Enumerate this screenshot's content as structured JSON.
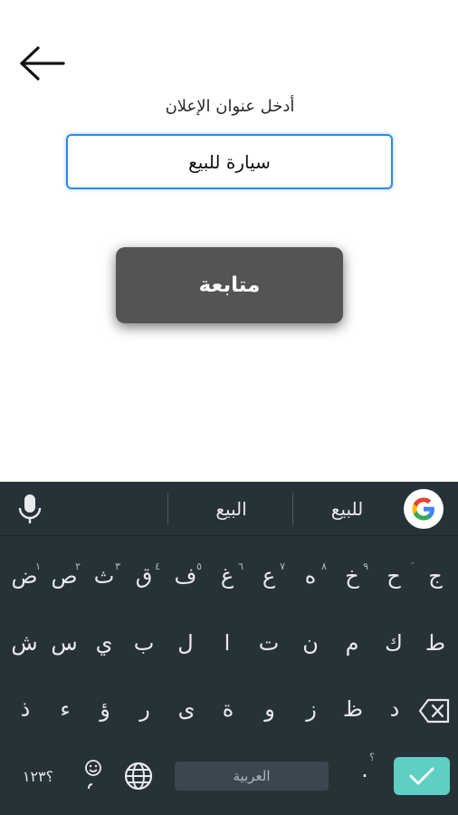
{
  "screen": {
    "title_label": "أدخل  عنوان الإعلان",
    "input_value": "سيارة للبيع",
    "continue_label": "متابعة"
  },
  "keyboard": {
    "suggestions": [
      "للبيع",
      "البيع"
    ],
    "row1": [
      {
        "key": "ج",
        "hint": ""
      },
      {
        "key": "ح",
        "hint": "َ"
      },
      {
        "key": "خ",
        "hint": "٩"
      },
      {
        "key": "ه",
        "hint": "٨"
      },
      {
        "key": "ع",
        "hint": "٧"
      },
      {
        "key": "غ",
        "hint": "٦"
      },
      {
        "key": "ف",
        "hint": "٥"
      },
      {
        "key": "ق",
        "hint": "٤"
      },
      {
        "key": "ث",
        "hint": "٣"
      },
      {
        "key": "ص",
        "hint": "٢"
      },
      {
        "key": "ض",
        "hint": "١"
      }
    ],
    "row2": [
      "ط",
      "ك",
      "م",
      "ن",
      "ت",
      "ا",
      "ل",
      "ب",
      "ي",
      "س",
      "ش"
    ],
    "row3": [
      "د",
      "ظ",
      "ز",
      "و",
      "ة",
      "ى",
      "ر",
      "ؤ",
      "ء",
      "ذ"
    ],
    "numbers_label": "؟١٢٣",
    "space_label": "العربية",
    "period_label": ".",
    "period_hint": "؟"
  },
  "colors": {
    "keyboard_bg": "#263238",
    "accent": "#5ecfc3",
    "input_border": "#2e8ae6",
    "button_bg": "#545454"
  }
}
